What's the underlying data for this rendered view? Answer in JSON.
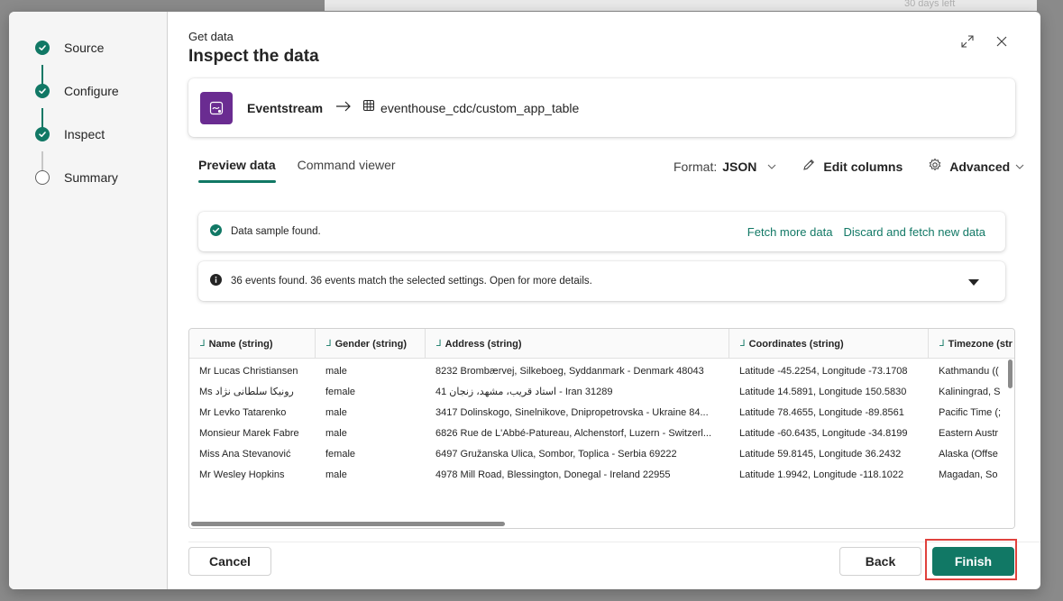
{
  "background": {
    "top_right_text": "30 days left"
  },
  "stepper": {
    "steps": [
      {
        "label": "Source",
        "status": "done"
      },
      {
        "label": "Configure",
        "status": "done"
      },
      {
        "label": "Inspect",
        "status": "done"
      },
      {
        "label": "Summary",
        "status": "todo"
      }
    ]
  },
  "header": {
    "breadcrumb": "Get data",
    "title": "Inspect the data"
  },
  "source_card": {
    "source_name": "Eventstream",
    "destination": "eventhouse_cdc/custom_app_table"
  },
  "tabs": [
    {
      "label": "Preview data",
      "active": true
    },
    {
      "label": "Command viewer",
      "active": false
    }
  ],
  "toolbar": {
    "format_label": "Format:",
    "format_value": "JSON",
    "edit_columns": "Edit columns",
    "advanced": "Advanced"
  },
  "sample_notice": {
    "message": "Data sample found.",
    "fetch_more": "Fetch more data",
    "discard_fetch": "Discard and fetch new data"
  },
  "events_notice": {
    "message": "36 events found. 36 events match the selected settings. Open for more details."
  },
  "table": {
    "columns": [
      "Name (string)",
      "Gender (string)",
      "Address (string)",
      "Coordinates (string)",
      "Timezone (str"
    ],
    "rows": [
      [
        "Mr Lucas Christiansen",
        "male",
        "8232 Brombærvej, Silkeboeg, Syddanmark - Denmark 48043",
        "Latitude -45.2254, Longitude -73.1708",
        "Kathmandu (("
      ],
      [
        "Ms رونیکا سلطانی نژاد",
        "female",
        "41 استاد قریب، مشهد، زنجان - Iran 31289",
        "Latitude 14.5891, Longitude 150.5830",
        "Kaliningrad, S"
      ],
      [
        "Mr Levko Tatarenko",
        "male",
        "3417 Dolinskogo, Sinelnikove, Dnipropetrovska - Ukraine 84...",
        "Latitude 78.4655, Longitude -89.8561",
        "Pacific Time (;"
      ],
      [
        "Monsieur Marek Fabre",
        "male",
        "6826 Rue de L'Abbé-Patureau, Alchenstorf, Luzern - Switzerl...",
        "Latitude -60.6435, Longitude -34.8199",
        "Eastern Austr"
      ],
      [
        "Miss Ana Stevanović",
        "female",
        "6497 Gružanska Ulica, Sombor, Toplica - Serbia 69222",
        "Latitude 59.8145, Longitude 36.2432",
        "Alaska (Offse"
      ],
      [
        "Mr Wesley Hopkins",
        "male",
        "4978 Mill Road, Blessington, Donegal - Ireland 22955",
        "Latitude 1.9942, Longitude -118.1022",
        "Magadan, So"
      ]
    ]
  },
  "footer": {
    "cancel": "Cancel",
    "back": "Back",
    "finish": "Finish"
  },
  "colors": {
    "accent": "#117865",
    "eventstream_tile": "#6a2c91",
    "highlight": "#e0423d"
  }
}
